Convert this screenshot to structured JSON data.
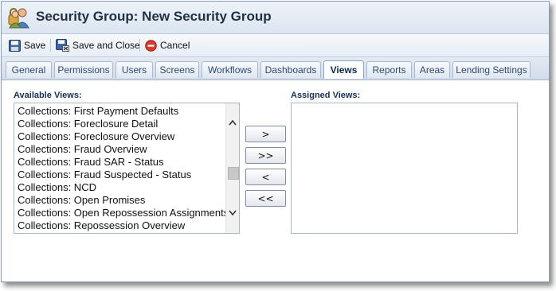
{
  "window": {
    "title": "Security Group: New Security Group"
  },
  "toolbar": {
    "save_label": "Save",
    "save_close_label": "Save and Close",
    "cancel_label": "Cancel"
  },
  "tabs": [
    {
      "label": "General"
    },
    {
      "label": "Permissions"
    },
    {
      "label": "Users"
    },
    {
      "label": "Screens"
    },
    {
      "label": "Workflows"
    },
    {
      "label": "Dashboards"
    },
    {
      "label": "Views",
      "active": true
    },
    {
      "label": "Reports"
    },
    {
      "label": "Areas"
    },
    {
      "label": "Lending Settings"
    }
  ],
  "available": {
    "label": "Available Views:",
    "items": [
      "Collections: First Payment Defaults",
      "Collections: Foreclosure Detail",
      "Collections: Foreclosure Overview",
      "Collections: Fraud Overview",
      "Collections: Fraud SAR - Status",
      "Collections: Fraud Suspected - Status",
      "Collections: NCD",
      "Collections: Open Promises",
      "Collections: Open Repossession Assignments",
      "Collections: Repossession Overview"
    ]
  },
  "assigned": {
    "label": "Assigned Views:",
    "items": []
  },
  "move_buttons": {
    "add": ">",
    "add_all": ">>",
    "remove": "<",
    "remove_all": "<<"
  },
  "colors": {
    "accent": "#15305a",
    "tab_text": "#2f4a6d",
    "cancel_icon": "#d93a2b"
  }
}
